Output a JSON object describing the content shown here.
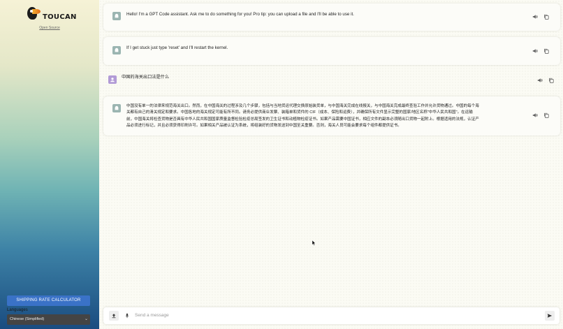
{
  "sidebar": {
    "brand": "TOUCAN",
    "open_source_link": "Open Source",
    "calc_button": "SHIPPING RATE CALCULATOR",
    "languages_label": "Languages",
    "language_selected": "Chinese (Simplified)"
  },
  "messages": [
    {
      "role": "assistant",
      "text": "Hello! I'm a GPT Code assistant. Ask me to do something for you! Pro tip: you can upload a file and I'll be able to use it."
    },
    {
      "role": "assistant",
      "text": "If I get stuck just type 'reset' and I'll restart the kernel."
    },
    {
      "role": "user",
      "text": "中国的海关出口法是什么"
    },
    {
      "role": "assistant",
      "lines": [
        "中国没有单一的法律来规范海关出口。然而，在中国海关的过程涉及几个步骤，包括与当地货运代理交换原始装货单，与中国海关完成在线报关，与中国海关完成最终查验工作并允许货物通过。中国的每个海",
        "关都有自己的清关规定和要求。中国各地的海关规定可能有所不同。请务必提供商业发票、装箱单和货件的 CIF（成本、保险和运费），并确保所有文件显示完整的国家/地区名称\"中华人民共和国\"。在运输",
        "前，中国海关将检查货物是否具有中华人民共和国国家质量监督检验检疫总局签发的卫生证书和动植物检疫证书。如果产品需要中国证书，相应文件的副本必须随出口货物一起附上。根据适用的法规，认证产",
        "品必须进行标记，并且必须获得印刷许可。如果相关产品被认证为系统，将组装好的货物发送到中国至关重要。否则，海关人员可能会要求每个组件都提供证书。"
      ]
    }
  ],
  "composer": {
    "placeholder": "Send a message"
  },
  "icons": {
    "speaker": "speaker-icon",
    "copy": "copy-icon",
    "upload": "upload-icon",
    "mic": "microphone-icon",
    "send": "send-icon"
  }
}
